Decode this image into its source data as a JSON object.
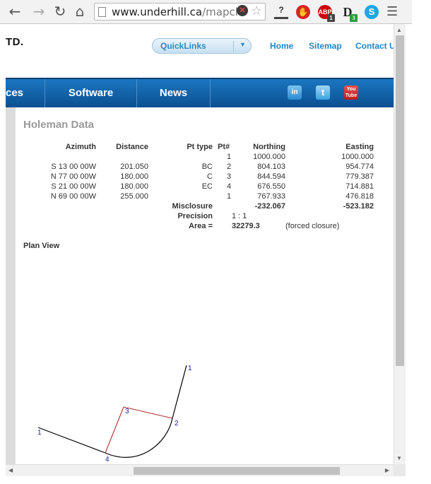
{
  "browser": {
    "url_host": "www.underhill.ca",
    "url_path": "/mapch",
    "nav": {
      "back": "←",
      "forward": "→",
      "reload": "↻",
      "home": "⌂"
    },
    "ext": {
      "stop": "✋",
      "abp": "ABP",
      "abp_badge": "1",
      "d": "D",
      "d_badge": "3",
      "s": "S",
      "help": "?"
    }
  },
  "header": {
    "logo_text": "TD.",
    "quicklinks_label": "QuickLinks",
    "links": [
      "Home",
      "Sitemap",
      "Contact U"
    ]
  },
  "nav": {
    "items": [
      "ces",
      "Software",
      "News"
    ],
    "social": {
      "linkedin": "in",
      "twitter": "t",
      "youtube": "You Tube"
    }
  },
  "holeman": {
    "title": "Holeman Data",
    "headers": {
      "azimuth": "Azimuth",
      "distance": "Distance",
      "pt_type": "Pt type",
      "pt_num": "Pt#",
      "northing": "Northing",
      "easting": "Easting"
    },
    "courses": [
      {
        "azimuth": "S 13 00 00W",
        "distance": "201.050"
      },
      {
        "azimuth": "N 77 00 00W",
        "distance": "180.000"
      },
      {
        "azimuth": "S 21 00 00W",
        "distance": "180.000"
      },
      {
        "azimuth": "N 69 00 00W",
        "distance": "255.000"
      }
    ],
    "points": [
      {
        "type": "",
        "num": "1",
        "northing": "1000.000",
        "easting": "1000.000"
      },
      {
        "type": "BC",
        "num": "2",
        "northing": "804.103",
        "easting": "954.774"
      },
      {
        "type": "C",
        "num": "3",
        "northing": "844.594",
        "easting": "779.387"
      },
      {
        "type": "EC",
        "num": "4",
        "northing": "676.550",
        "easting": "714.881"
      },
      {
        "type": "",
        "num": "1",
        "northing": "767.933",
        "easting": "476.818"
      }
    ],
    "misclosure": {
      "label": "Misclosure",
      "northing": "-232.067",
      "easting": "-523.182"
    },
    "precision": {
      "label": "Precision",
      "value": "1 : 1"
    },
    "area": {
      "label": "Area =",
      "value": "32279.3",
      "note": "(forced closure)"
    }
  },
  "plan": {
    "title": "Plan View",
    "labels": [
      "1",
      "2",
      "3",
      "4",
      "1"
    ],
    "colors": {
      "line": "#000000",
      "radius": "#b03030",
      "label": "#1a1aa0"
    }
  }
}
